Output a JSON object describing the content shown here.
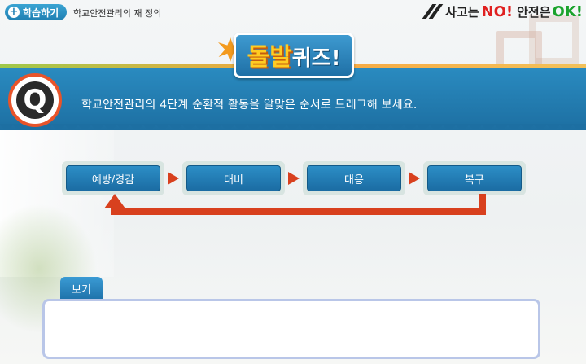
{
  "header": {
    "learn_label": "학습하기",
    "title": "학교안전관리의 재 정의",
    "slogan": {
      "text1": "사고는",
      "no": "NO!",
      "text2": "안전은",
      "ok": "OK!"
    }
  },
  "quiz": {
    "title_part1": "돌발",
    "title_part2": "퀴즈!",
    "question_icon": "Q",
    "question": "학교안전관리의 4단계 순환적 활동을 알맞은 순서로 드래그해 보세요."
  },
  "flow": {
    "steps": [
      {
        "label": "예방/경감"
      },
      {
        "label": "대비"
      },
      {
        "label": "대응"
      },
      {
        "label": "복구"
      }
    ]
  },
  "answer": {
    "tab_label": "보기"
  },
  "colors": {
    "accent_blue": "#1f7fb2",
    "arrow_red": "#d8401e",
    "no_red": "#e02020",
    "ok_green": "#1aa32c"
  }
}
